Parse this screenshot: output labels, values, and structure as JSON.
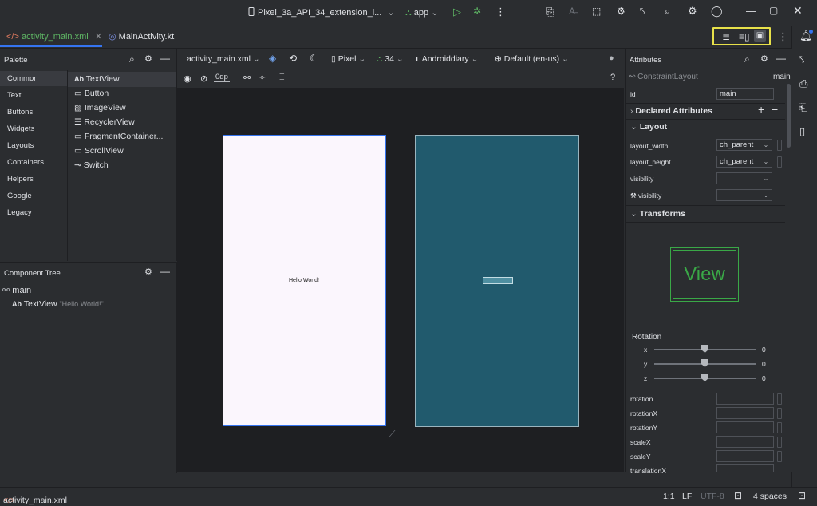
{
  "titlebar": {
    "device": "Pixel_3a_API_34_extension_l...",
    "run_config": "app"
  },
  "tabs": [
    {
      "label": "activity_main.xml",
      "active": true
    },
    {
      "label": "MainActivity.kt",
      "active": false
    }
  ],
  "palette": {
    "title": "Palette",
    "categories": [
      "Common",
      "Text",
      "Buttons",
      "Widgets",
      "Layouts",
      "Containers",
      "Helpers",
      "Google",
      "Legacy"
    ],
    "selected_category": "Common",
    "items": [
      "TextView",
      "Button",
      "ImageView",
      "RecyclerView",
      "FragmentContainer...",
      "ScrollView",
      "Switch"
    ]
  },
  "component_tree": {
    "title": "Component Tree",
    "root": "main",
    "child_type": "TextView",
    "child_text": "\"Hello World!\""
  },
  "design_toolbar": {
    "file": "activity_main.xml",
    "device": "Pixel",
    "api": "34",
    "theme": "Androiddiary",
    "locale": "Default (en-us)",
    "margin": "0dp"
  },
  "design_preview": {
    "text": "Hello World!"
  },
  "attributes": {
    "title": "Attributes",
    "layout_type": "ConstraintLayout",
    "view_id": "main",
    "id_label": "id",
    "id_value": "main",
    "declared_section": "Declared Attributes",
    "layout_section": "Layout",
    "layout_width_label": "layout_width",
    "layout_width_value": "ch_parent",
    "layout_height_label": "layout_height",
    "layout_height_value": "ch_parent",
    "visibility_label": "visibility",
    "tools_visibility_label": "visibility",
    "transforms_section": "Transforms",
    "view_preview_label": "View",
    "rotation_label": "Rotation",
    "rot_x_label": "x",
    "rot_y_label": "y",
    "rot_z_label": "z",
    "rot_x_value": "0",
    "rot_y_value": "0",
    "rot_z_value": "0",
    "fields": [
      "rotation",
      "rotationX",
      "rotationY",
      "scaleX",
      "scaleY",
      "translationX"
    ]
  },
  "statusbar": {
    "file": "activity_main.xml",
    "position": "1:1",
    "line_sep": "LF",
    "encoding": "UTF-8",
    "indent": "4 spaces"
  },
  "colors": {
    "accent": "#3574f0",
    "highlight": "#e8e14a",
    "blueprint": "#215a6d",
    "active_tab": "#5fb865"
  }
}
